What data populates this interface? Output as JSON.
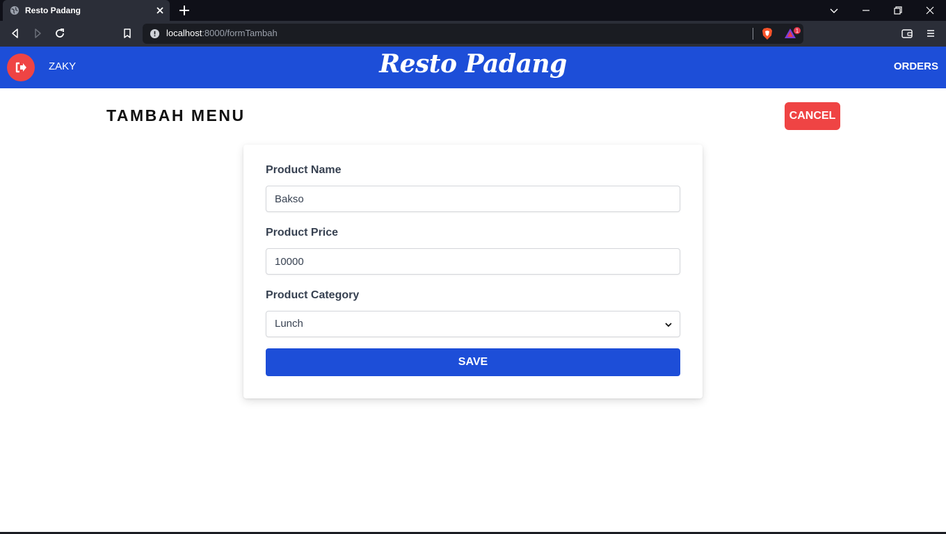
{
  "browser": {
    "tab_title": "Resto Padang",
    "url_host": "localhost",
    "url_rest": ":8000/formTambah",
    "rewards_badge": "1"
  },
  "navbar": {
    "username": "ZAKY",
    "brand": "Resto Padang",
    "orders_label": "ORDERS",
    "color": "#1d4ed8"
  },
  "page": {
    "title": "TAMBAH MENU",
    "cancel_label": "CANCEL"
  },
  "form": {
    "name_label": "Product Name",
    "name_value": "Bakso",
    "price_label": "Product Price",
    "price_value": "10000",
    "category_label": "Product Category",
    "category_value": "Lunch",
    "save_label": "SAVE"
  },
  "colors": {
    "accent": "#1d4ed8",
    "danger": "#ef4444"
  }
}
